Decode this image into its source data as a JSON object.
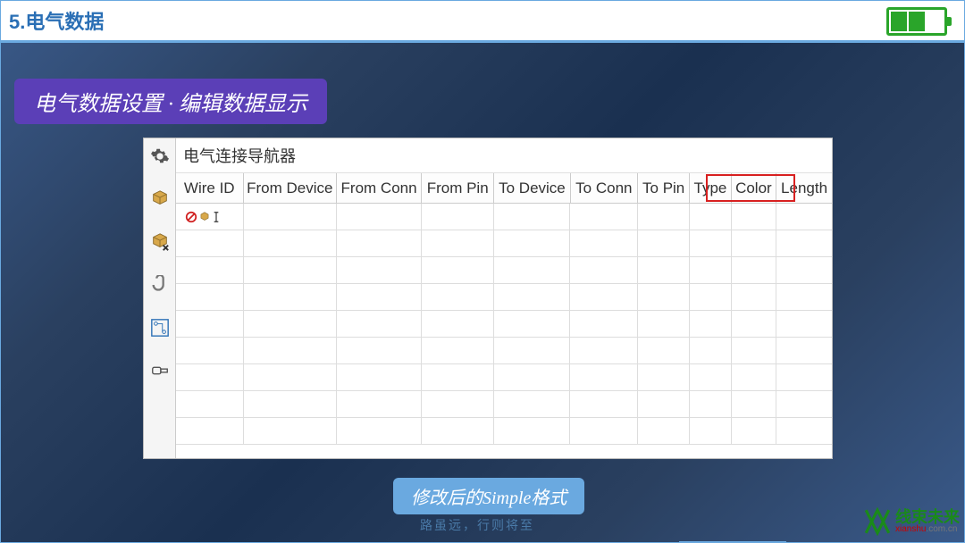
{
  "header": {
    "title": "5.电气数据"
  },
  "subtitle": "电气数据设置 · 编辑数据显示",
  "pane": {
    "title": "电气连接导航器",
    "columns": [
      "Wire ID",
      "From Device",
      "From Conn",
      "From Pin",
      "To Device",
      "To Conn",
      "To Pin",
      "Type",
      "Color",
      "Length"
    ],
    "highlighted_columns": [
      "Type",
      "Color"
    ],
    "row_count": 9
  },
  "caption": "修改后的Simple格式",
  "footer": "路虽远，行则将至",
  "watermark": {
    "cn": "线束未来",
    "en_pre": "xianshu",
    "en_suf": ".com.cn"
  }
}
